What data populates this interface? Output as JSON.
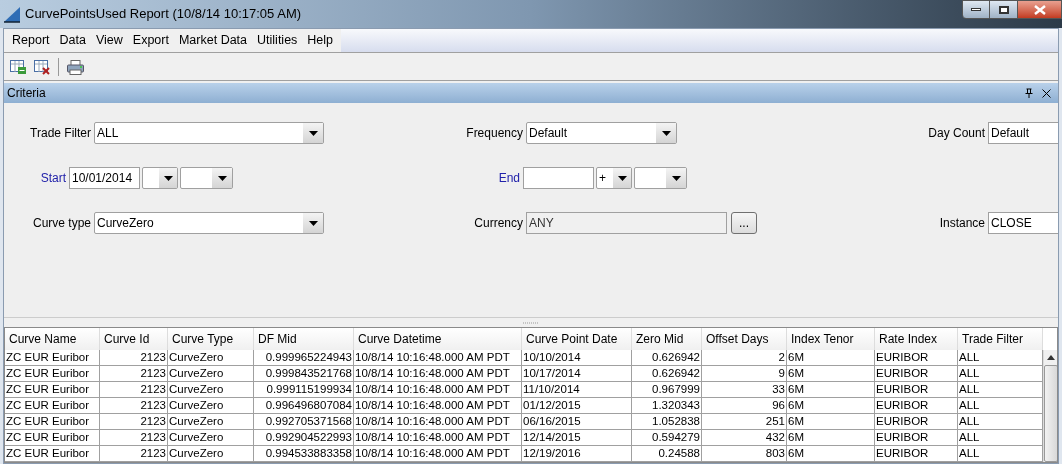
{
  "window": {
    "title": "CurvePointsUsed Report (10/8/14 10:17:05 AM)"
  },
  "menu": [
    "Report",
    "Data",
    "View",
    "Export",
    "Market Data",
    "Utilities",
    "Help"
  ],
  "panel": {
    "title": "Criteria"
  },
  "criteria": [
    [
      {
        "kind": "combo",
        "label": "Trade Filter",
        "value": "ALL",
        "link": false
      },
      {
        "kind": "combo",
        "label": "Frequency",
        "value": "Default",
        "link": false
      },
      {
        "kind": "text",
        "label": "Day Count",
        "value": "Default",
        "link": false
      }
    ],
    [
      {
        "kind": "date",
        "label": "Start",
        "value": "10/01/2014",
        "link": true
      },
      {
        "kind": "date",
        "label": "End",
        "sign": "+",
        "link": true
      }
    ],
    [
      {
        "kind": "combo",
        "label": "Curve type",
        "value": "CurveZero",
        "link": false
      },
      {
        "kind": "picker",
        "label": "Currency",
        "value": "ANY",
        "button": "...",
        "link": false
      },
      {
        "kind": "text",
        "label": "Instance",
        "value": "CLOSE",
        "link": false
      }
    ]
  ],
  "table": {
    "columns": [
      {
        "label": "Curve Name",
        "numeric": false
      },
      {
        "label": "Curve Id",
        "numeric": true
      },
      {
        "label": "Curve Type",
        "numeric": false
      },
      {
        "label": "DF Mid",
        "numeric": true
      },
      {
        "label": "Curve Datetime",
        "numeric": false
      },
      {
        "label": "Curve Point Date",
        "numeric": false
      },
      {
        "label": "Zero Mid",
        "numeric": true
      },
      {
        "label": "Offset Days",
        "numeric": true
      },
      {
        "label": "Index Tenor",
        "numeric": false
      },
      {
        "label": "Rate Index",
        "numeric": false
      },
      {
        "label": "Trade Filter",
        "numeric": false
      }
    ],
    "rows": [
      [
        "ZC EUR Euribor",
        "2123",
        "CurveZero",
        "0.999965224943",
        "10/8/14 10:16:48.000 AM PDT",
        "10/10/2014",
        "0.626942",
        "2",
        "6M",
        "EURIBOR",
        "ALL"
      ],
      [
        "ZC EUR Euribor",
        "2123",
        "CurveZero",
        "0.999843521768",
        "10/8/14 10:16:48.000 AM PDT",
        "10/17/2014",
        "0.626942",
        "9",
        "6M",
        "EURIBOR",
        "ALL"
      ],
      [
        "ZC EUR Euribor",
        "2123",
        "CurveZero",
        "0.999115199934",
        "10/8/14 10:16:48.000 AM PDT",
        "11/10/2014",
        "0.967999",
        "33",
        "6M",
        "EURIBOR",
        "ALL"
      ],
      [
        "ZC EUR Euribor",
        "2123",
        "CurveZero",
        "0.996496807084",
        "10/8/14 10:16:48.000 AM PDT",
        "01/12/2015",
        "1.320343",
        "96",
        "6M",
        "EURIBOR",
        "ALL"
      ],
      [
        "ZC EUR Euribor",
        "2123",
        "CurveZero",
        "0.992705371568",
        "10/8/14 10:16:48.000 AM PDT",
        "06/16/2015",
        "1.052838",
        "251",
        "6M",
        "EURIBOR",
        "ALL"
      ],
      [
        "ZC EUR Euribor",
        "2123",
        "CurveZero",
        "0.992904522993",
        "10/8/14 10:16:48.000 AM PDT",
        "12/14/2015",
        "0.594279",
        "432",
        "6M",
        "EURIBOR",
        "ALL"
      ],
      [
        "ZC EUR Euribor",
        "2123",
        "CurveZero",
        "0.994533883358",
        "10/8/14 10:16:48.000 AM PDT",
        "12/19/2016",
        "0.24588",
        "803",
        "6M",
        "EURIBOR",
        "ALL"
      ]
    ]
  }
}
